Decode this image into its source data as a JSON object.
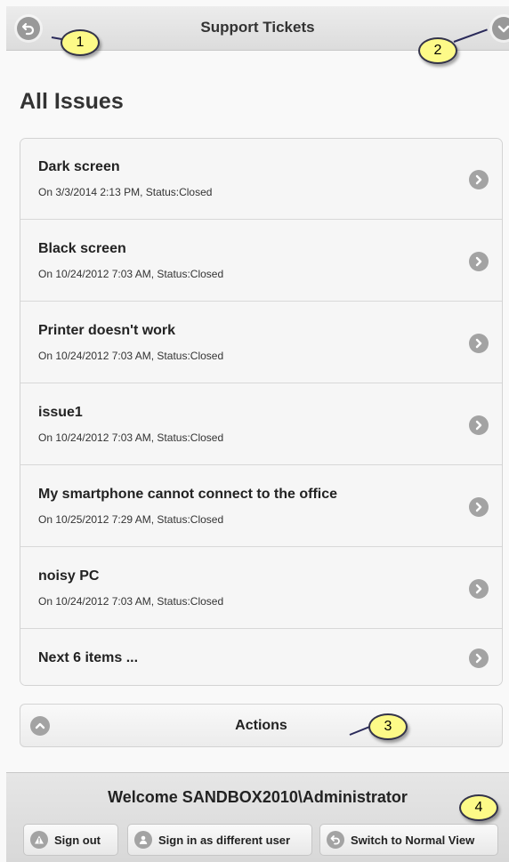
{
  "header": {
    "title": "Support Tickets",
    "back_icon": "back-arrow-icon",
    "menu_icon": "chevron-down-icon"
  },
  "page": {
    "title": "All Issues"
  },
  "issues": [
    {
      "title": "Dark screen",
      "subtitle": "On 3/3/2014 2:13 PM, Status:Closed"
    },
    {
      "title": "Black screen",
      "subtitle": "On 10/24/2012 7:03 AM, Status:Closed"
    },
    {
      "title": "Printer doesn't work",
      "subtitle": "On 10/24/2012 7:03 AM, Status:Closed"
    },
    {
      "title": "issue1",
      "subtitle": "On 10/24/2012 7:03 AM, Status:Closed"
    },
    {
      "title": "My smartphone cannot connect to the office",
      "subtitle": "On 10/25/2012 7:29 AM, Status:Closed"
    },
    {
      "title": "noisy PC",
      "subtitle": "On 10/24/2012 7:03 AM, Status:Closed"
    }
  ],
  "next_items": {
    "label": "Next 6 items ..."
  },
  "actions": {
    "label": "Actions"
  },
  "footer": {
    "welcome": "Welcome SANDBOX2010\\Administrator",
    "sign_out": "Sign out",
    "sign_in_different": "Sign in as different user",
    "switch_view": "Switch to Normal View"
  },
  "callouts": [
    "1",
    "2",
    "3",
    "4"
  ],
  "colors": {
    "callout_fill": "#fdfa88",
    "icon_gray": "#a3a3a3",
    "header_bg": "#e2e2e2"
  }
}
